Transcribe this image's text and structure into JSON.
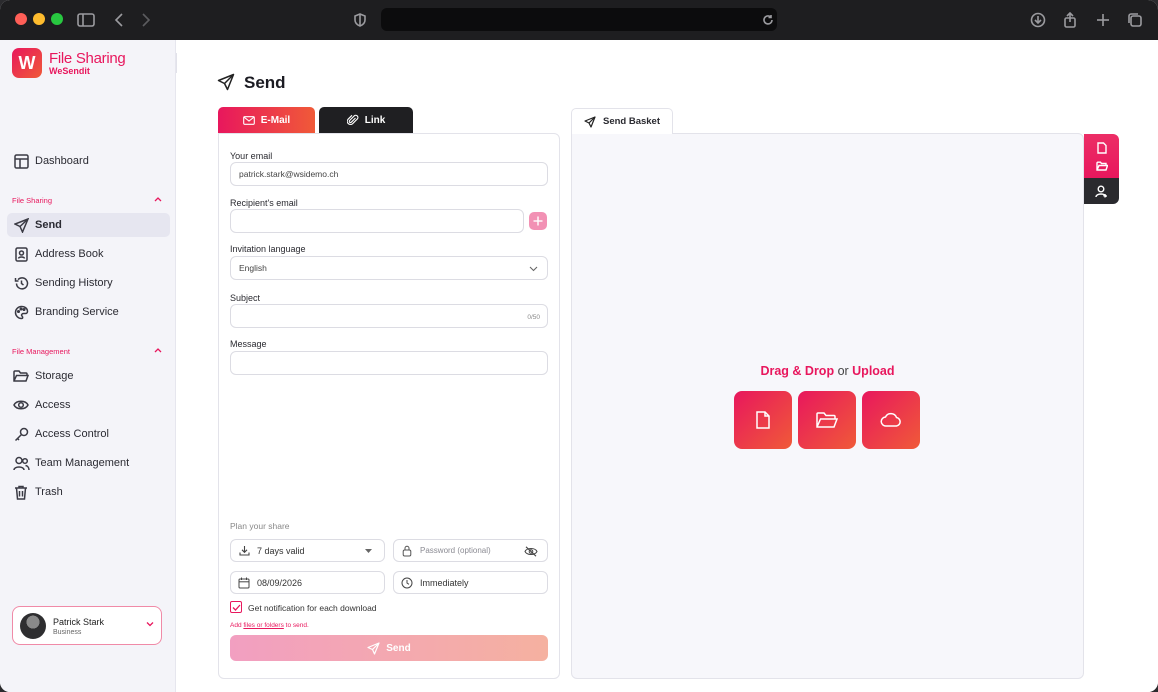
{
  "browser": {
    "traffic_lights": [
      "#ff5f57",
      "#febc2e",
      "#28c840"
    ]
  },
  "brand": {
    "logo_letter": "W",
    "title": "File Sharing",
    "subtitle": "WeSendit"
  },
  "sidebar": {
    "dashboard": "Dashboard",
    "section_file_sharing": "File Sharing",
    "file_sharing_items": [
      {
        "label": "Send",
        "icon": "send-icon"
      },
      {
        "label": "Address Book",
        "icon": "address-book-icon"
      },
      {
        "label": "Sending History",
        "icon": "history-icon"
      },
      {
        "label": "Branding Service",
        "icon": "palette-icon"
      }
    ],
    "section_file_management": "File Management",
    "file_management_items": [
      {
        "label": "Storage",
        "icon": "folder-icon"
      },
      {
        "label": "Access",
        "icon": "eye-icon"
      },
      {
        "label": "Access Control",
        "icon": "key-icon"
      },
      {
        "label": "Team Management",
        "icon": "team-icon"
      },
      {
        "label": "Trash",
        "icon": "trash-icon"
      }
    ]
  },
  "user": {
    "name": "Patrick Stark",
    "plan": "Business"
  },
  "page": {
    "title": "Send"
  },
  "tabs": {
    "email": "E-Mail",
    "link": "Link"
  },
  "form": {
    "your_email_label": "Your email",
    "your_email_value": "patrick.stark@wsidemo.ch",
    "recipient_label": "Recipient's email",
    "recipient_value": "",
    "language_label": "Invitation language",
    "language_value": "English",
    "subject_label": "Subject",
    "subject_counter": "0/50",
    "message_label": "Message",
    "plan_label": "Plan your share",
    "validity": "7 days valid",
    "password_placeholder": "Password (optional)",
    "date": "08/09/2026",
    "timing": "Immediately",
    "notify_label": "Get notification for each download",
    "hint_prefix": "Add ",
    "hint_link": "files or folders",
    "hint_suffix": " to send.",
    "send_button": "Send"
  },
  "basket": {
    "tab": "Send Basket",
    "drag_drop": "Drag & Drop",
    "or": " or ",
    "upload": "Upload"
  },
  "colors": {
    "accent": "#e8175d",
    "accent2": "#f05a38",
    "dark_tab": "#1f1f22"
  }
}
